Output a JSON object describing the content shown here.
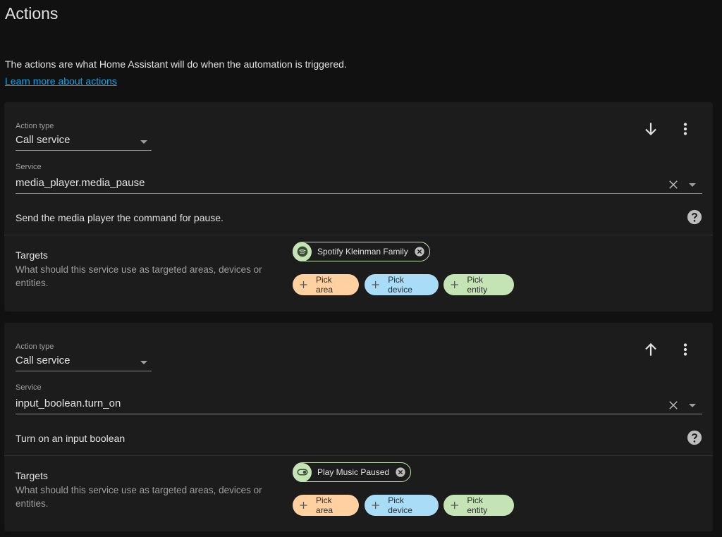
{
  "page": {
    "title": "Actions",
    "intro": "The actions are what Home Assistant will do when the automation is triggered.",
    "learn_more": "Learn more about actions"
  },
  "actions": [
    {
      "action_type_label": "Action type",
      "action_type_value": "Call service",
      "service_label": "Service",
      "service_value": "media_player.media_pause",
      "description": "Send the media player the command for pause.",
      "move_icon": "arrow-down-icon",
      "targets_title": "Targets",
      "targets_description": "What should this service use as targeted areas, devices or entities.",
      "selected_target": {
        "label": "Spotify Kleinman Family",
        "icon": "spotify-icon"
      },
      "pick_area": "Pick area",
      "pick_device": "Pick device",
      "pick_entity": "Pick entity"
    },
    {
      "action_type_label": "Action type",
      "action_type_value": "Call service",
      "service_label": "Service",
      "service_value": "input_boolean.turn_on",
      "description": "Turn on an input boolean",
      "move_icon": "arrow-up-icon",
      "targets_title": "Targets",
      "targets_description": "What should this service use as targeted areas, devices or entities.",
      "selected_target": {
        "label": "Play Music Paused",
        "icon": "toggle-switch-icon"
      },
      "pick_area": "Pick area",
      "pick_device": "Pick device",
      "pick_entity": "Pick entity"
    }
  ],
  "colors": {
    "background": "#111111",
    "card": "#1c1c1c",
    "link": "#03a9f4",
    "area_chip": "#ffd0a0",
    "device_chip": "#a8dcf7",
    "entity_chip": "#c5e4b5"
  }
}
